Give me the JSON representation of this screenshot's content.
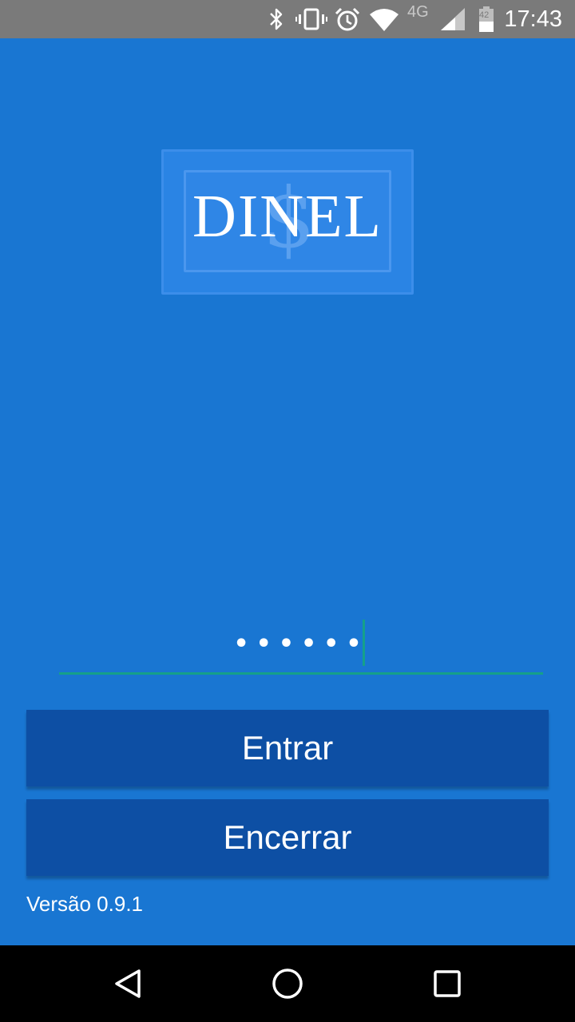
{
  "status_bar": {
    "time": "17:43",
    "network_label": "4G",
    "battery_level": "42",
    "icons": [
      "bluetooth-icon",
      "vibrate-icon",
      "alarm-icon",
      "wifi-icon",
      "signal-icon",
      "battery-icon"
    ]
  },
  "logo": {
    "text": "DINEL",
    "symbol": "$"
  },
  "login": {
    "password_masked": "••••••"
  },
  "buttons": {
    "enter_label": "Entrar",
    "close_label": "Encerrar"
  },
  "footer": {
    "version": "Versão 0.9.1"
  },
  "nav_bar": {
    "icons": [
      "back-icon",
      "home-icon",
      "recents-icon"
    ]
  },
  "colors": {
    "background": "#1976d2",
    "button": "#0d4fa4",
    "accent": "#15a08a",
    "status_bar": "#7a7a7a"
  }
}
